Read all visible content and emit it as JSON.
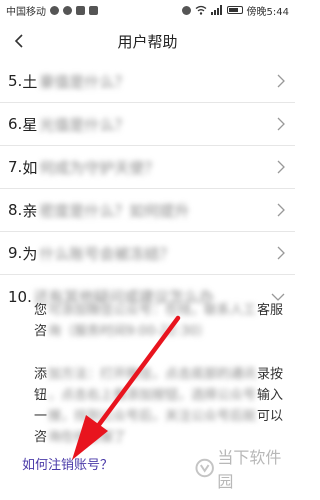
{
  "status_bar": {
    "carrier": "中国移动",
    "time": "傍晚5:44",
    "battery_label": "",
    "icons": [
      "signal-icon",
      "wifi-icon",
      "chat-icon",
      "alarm-icon",
      "battery-icon"
    ]
  },
  "nav": {
    "title": "用户帮助",
    "back_icon": "chevron-left-icon"
  },
  "faq": [
    {
      "number": "5.",
      "visible": "土",
      "blurred": "豪值是什么？"
    },
    {
      "number": "6.",
      "visible": "星",
      "blurred": "光值是什么？"
    },
    {
      "number": "7.",
      "visible": "如",
      "blurred": "何成为守护天使？"
    },
    {
      "number": "8.",
      "visible": "亲",
      "blurred": "密度是什么？如何提升"
    },
    {
      "number": "9.",
      "visible": "为",
      "blurred": "什么账号会被冻结？"
    },
    {
      "number": "10.",
      "visible": "",
      "blurred": "还有其他疑问或建议怎么办"
    }
  ],
  "answer": {
    "lines": [
      {
        "before": "您",
        "blur": "可添加微信公众号：在线，联系人工",
        "after": "客服"
      },
      {
        "before": "咨",
        "blur": "询（服务时间9:00-22:30）",
        "after": ""
      },
      {
        "gap": true
      },
      {
        "before": "添",
        "blur": "加方法：打开微信，点击底部的通讯",
        "after": "录按"
      },
      {
        "before": "钮",
        "blur": "，点击右上角添加按钮，选择公众号",
        "after": "输入"
      },
      {
        "before": "一",
        "blur": "搜，找到公众号后，关注公众号后就",
        "after": "可以"
      },
      {
        "before": "咨",
        "blur": "询在线客服了",
        "after": ""
      }
    ]
  },
  "cancel_link": "如何注销账号？",
  "watermark": {
    "text": "当下软件园",
    "icon": "logo-icon"
  },
  "colors": {
    "arrow": "#e8141e",
    "link": "#4a3aa8",
    "divider": "#e6e6e6"
  }
}
